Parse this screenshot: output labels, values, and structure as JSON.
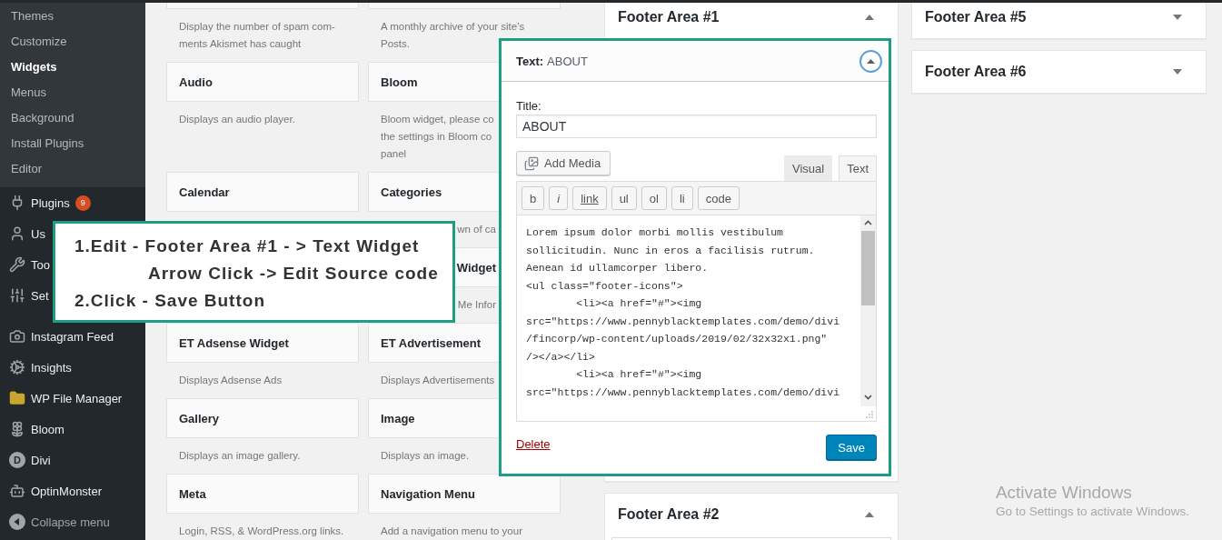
{
  "sidebar": {
    "submenu": [
      {
        "label": "Themes",
        "selected": false
      },
      {
        "label": "Customize",
        "selected": false
      },
      {
        "label": "Widgets",
        "selected": true
      },
      {
        "label": "Menus",
        "selected": false
      },
      {
        "label": "Background",
        "selected": false
      },
      {
        "label": "Install Plugins",
        "selected": false
      },
      {
        "label": "Editor",
        "selected": false
      }
    ],
    "menu_groups": [
      {
        "items": [
          {
            "label": "Plugins",
            "badge": "9"
          },
          {
            "label": "Us"
          },
          {
            "label": "Too"
          },
          {
            "label": "Set"
          }
        ]
      },
      {
        "items": [
          {
            "label": "Instagram Feed"
          },
          {
            "label": "Insights"
          },
          {
            "label": "WP File Manager"
          },
          {
            "label": "Bloom"
          },
          {
            "label": "Divi",
            "icon_letter": "D"
          },
          {
            "label": "OptinMonster"
          }
        ]
      }
    ],
    "collapse_label": "Collapse menu"
  },
  "available_widgets": {
    "rows": [
      {
        "left": {
          "description": "Display the number of spam com-\nments Akismet has caught"
        },
        "right": {
          "description": "A monthly archive of your site’s\nPosts."
        }
      },
      {
        "left": {
          "title": "Audio",
          "description": "Displays an audio player."
        },
        "right": {
          "title": "Bloom",
          "description": "Bloom widget, please co\nthe settings in Bloom co\npanel"
        }
      },
      {
        "left": {
          "title": "Calendar"
        },
        "right": {
          "title": "Categories",
          "title_covered_left": false,
          "description": "wn of ca",
          "description_covered_left": true
        }
      },
      {
        "right": {
          "title": "Widget",
          "title_covered_left": true,
          "description": "Me Infor",
          "description_covered_left": true
        }
      },
      {
        "left": {
          "title": "ET Adsense Widget",
          "description": "Displays Adsense Ads"
        },
        "right": {
          "title": "ET Advertisement",
          "description": "Displays Advertisements"
        }
      },
      {
        "left": {
          "title": "Gallery",
          "description": "Displays an image gallery."
        },
        "right": {
          "title": "Image",
          "description": "Displays an image."
        }
      },
      {
        "left": {
          "title": "Meta",
          "description": "Login, RSS, & WordPress.org links."
        },
        "right": {
          "title": "Navigation Menu",
          "description": "Add a navigation menu to your"
        }
      }
    ]
  },
  "footer_columns": [
    {
      "areas": [
        {
          "title": "Footer Area #1",
          "expanded": true,
          "widgets": [
            {
              "type_label": "Text:",
              "title": "ABOUT",
              "expanded": true,
              "title_label": "Title:",
              "title_value": "ABOUT",
              "add_media": "Add Media",
              "tabs": [
                {
                  "label": "Visual",
                  "selected": false
                },
                {
                  "label": "Text",
                  "selected": true
                }
              ],
              "quicktags": [
                {
                  "label": "b",
                  "kind": "plain"
                },
                {
                  "label": "i",
                  "kind": "italic"
                },
                {
                  "label": "link",
                  "kind": "link"
                },
                {
                  "label": "ul",
                  "kind": "plain"
                },
                {
                  "label": "ol",
                  "kind": "plain"
                },
                {
                  "label": "li",
                  "kind": "plain"
                },
                {
                  "label": "code",
                  "kind": "plain"
                }
              ],
              "content": "Lorem ipsum dolor morbi mollis vestibulum\nsollicitudin. Nunc in eros a facilisis rutrum.\nAenean id ullamcorper libero.\n<ul class=\"footer-icons\">\n\t<li><a href=\"#\"><img\nsrc=\"https://www.pennyblacktemplates.com/demo/divi\n/fincorp/wp-content/uploads/2019/02/32x32x1.png\"\n/></a></li>\n\t<li><a href=\"#\"><img\nsrc=\"https://www.pennyblacktemplates.com/demo/divi",
              "delete_label": "Delete",
              "save_label": "Save"
            }
          ]
        },
        {
          "title": "Footer Area #2",
          "expanded": true
        }
      ]
    },
    {
      "areas": [
        {
          "title": "Footer Area #5",
          "expanded": false
        },
        {
          "title": "Footer Area #6",
          "expanded": false
        }
      ]
    }
  ],
  "callout": {
    "lines": [
      {
        "kind": "step",
        "text": "1.Edit - Footer Area #1 - > Text Widget"
      },
      {
        "kind": "continuation",
        "text": "Arrow Click -> Edit Source code"
      },
      {
        "kind": "step",
        "text": "2.Click - Save Button"
      }
    ]
  },
  "os_notice": {
    "title": "Activate Windows",
    "message": "Go to Settings to activate Windows."
  }
}
